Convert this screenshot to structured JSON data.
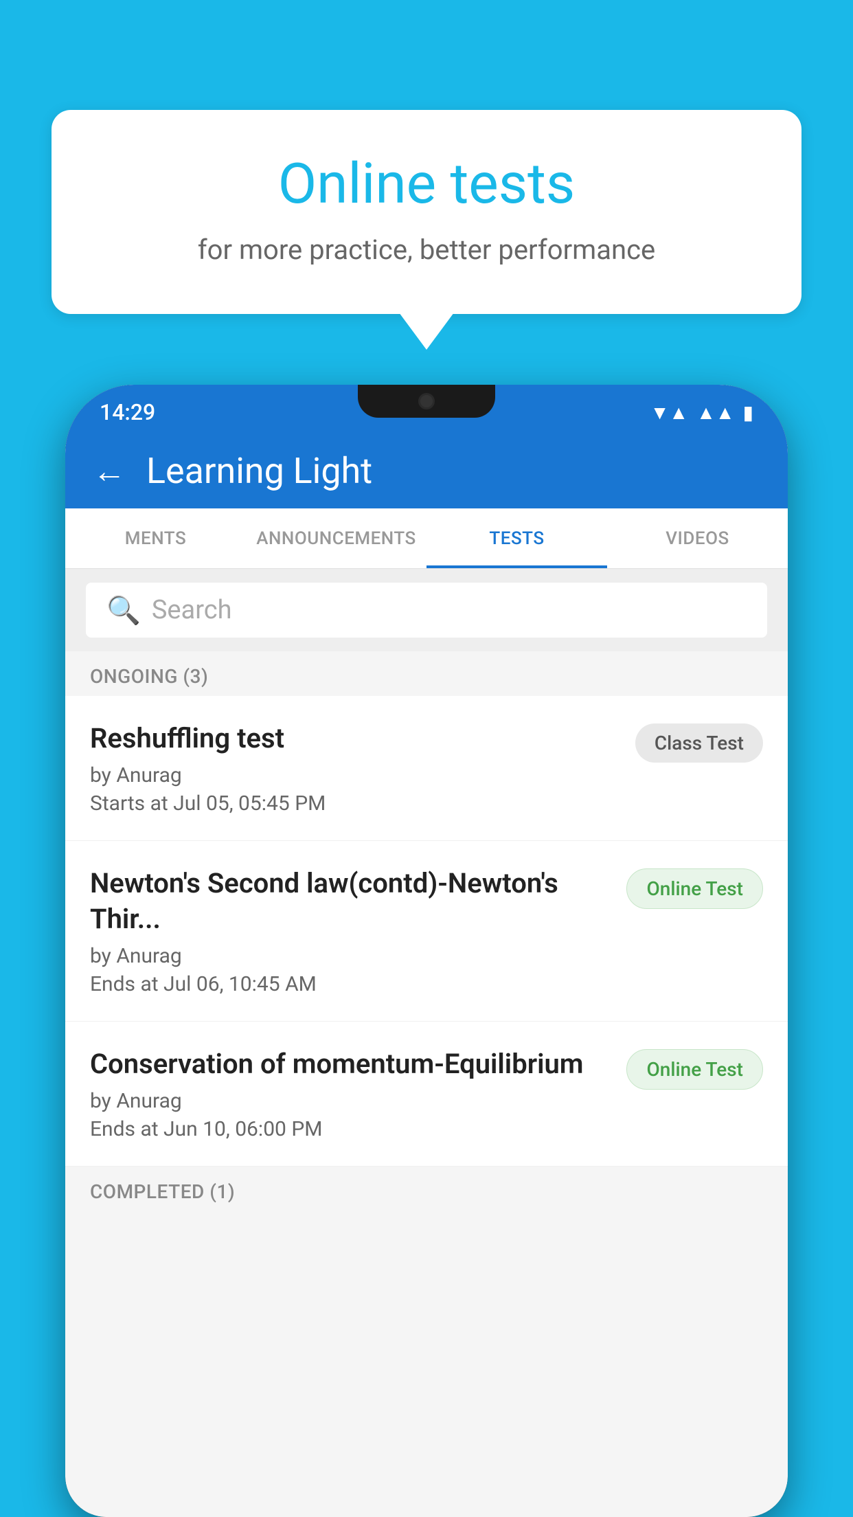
{
  "background": {
    "color": "#1ab8e8"
  },
  "speech_bubble": {
    "title": "Online tests",
    "subtitle": "for more practice, better performance"
  },
  "phone": {
    "status_bar": {
      "time": "14:29",
      "icons": [
        "wifi",
        "signal",
        "battery"
      ]
    },
    "app_header": {
      "title": "Learning Light",
      "back_label": "←"
    },
    "tabs": [
      {
        "label": "MENTS",
        "active": false
      },
      {
        "label": "ANNOUNCEMENTS",
        "active": false
      },
      {
        "label": "TESTS",
        "active": true
      },
      {
        "label": "VIDEOS",
        "active": false
      }
    ],
    "search": {
      "placeholder": "Search"
    },
    "sections": [
      {
        "label": "ONGOING (3)",
        "items": [
          {
            "name": "Reshuffling test",
            "author": "by Anurag",
            "time": "Starts at  Jul 05, 05:45 PM",
            "badge": "Class Test",
            "badge_type": "class"
          },
          {
            "name": "Newton's Second law(contd)-Newton's Thir...",
            "author": "by Anurag",
            "time": "Ends at  Jul 06, 10:45 AM",
            "badge": "Online Test",
            "badge_type": "online"
          },
          {
            "name": "Conservation of momentum-Equilibrium",
            "author": "by Anurag",
            "time": "Ends at  Jun 10, 06:00 PM",
            "badge": "Online Test",
            "badge_type": "online"
          }
        ]
      }
    ],
    "completed_label": "COMPLETED (1)"
  }
}
